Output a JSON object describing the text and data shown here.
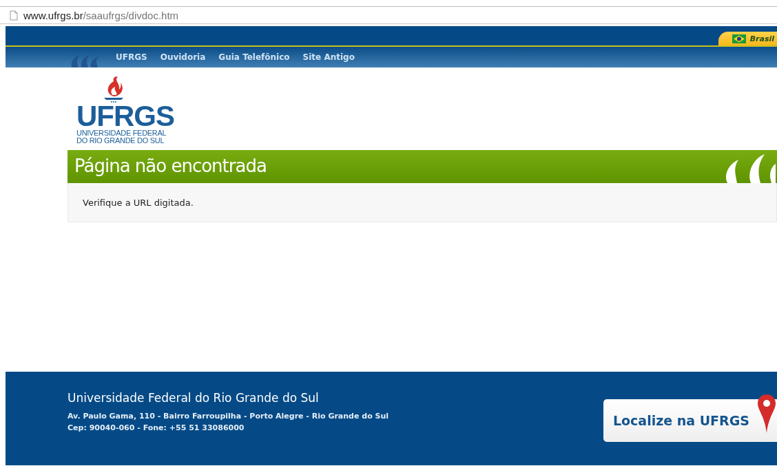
{
  "address_bar": {
    "host": "www.ufrgs.br",
    "path": "/saaufrgs/divdoc.htm"
  },
  "country_tab": {
    "label": "Brasil"
  },
  "nav": [
    {
      "label": "UFRGS"
    },
    {
      "label": "Ouvidoria"
    },
    {
      "label": "Guia Telefônico"
    },
    {
      "label": "Site Antigo"
    }
  ],
  "logo": {
    "acronym": "UFRGS",
    "line_1": "UNIVERSIDADE FEDERAL",
    "line_2": "DO RIO GRANDE DO SUL"
  },
  "page_title": "Página não encontrada",
  "message": "Verifique a URL digitada.",
  "footer": {
    "title": "Universidade Federal do Rio Grande do Sul",
    "address": "Av. Paulo Gama, 110 - Bairro Farroupilha - Porto Alegre - Rio Grande do Sul",
    "contact": "Cep: 90040-060 - Fone: +55 51 33086000",
    "map_button": "Localize na UFRGS"
  }
}
